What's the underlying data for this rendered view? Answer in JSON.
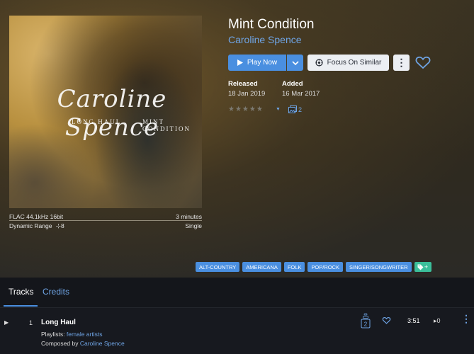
{
  "album": {
    "title": "Mint Condition",
    "artist": "Caroline Spence",
    "cover": {
      "script_text": "Caroline Spence",
      "sub_left": "LONG HAUL",
      "sub_right": "MINT CONDITION"
    },
    "format": "FLAC 44.1kHz 16bit",
    "duration": "3 minutes",
    "dynamic_range_label": "Dynamic Range",
    "dynamic_range_value": "8",
    "release_type": "Single",
    "released_label": "Released",
    "released_value": "18 Jan 2019",
    "added_label": "Added",
    "added_value": "16 Mar 2017",
    "rating": 0,
    "edition_count": "2"
  },
  "actions": {
    "play_label": "Play Now",
    "focus_label": "Focus On Similar"
  },
  "tags": [
    "ALT-COUNTRY",
    "AMERICANA",
    "FOLK",
    "POP/ROCK",
    "SINGER/SONGWRITER"
  ],
  "tabs": {
    "tracks": "Tracks",
    "credits": "Credits"
  },
  "tracks": [
    {
      "number": "1",
      "title": "Long Haul",
      "playlists_label": "Playlists:",
      "playlists_value": "female artists",
      "composed_label": "Composed by",
      "composed_value": "Caroline Spence",
      "versions": "2",
      "duration": "3:51",
      "plays": "0"
    }
  ],
  "colors": {
    "accent": "#4a8fe0",
    "link": "#6fa5e6",
    "tag_add": "#3bbf9a"
  }
}
